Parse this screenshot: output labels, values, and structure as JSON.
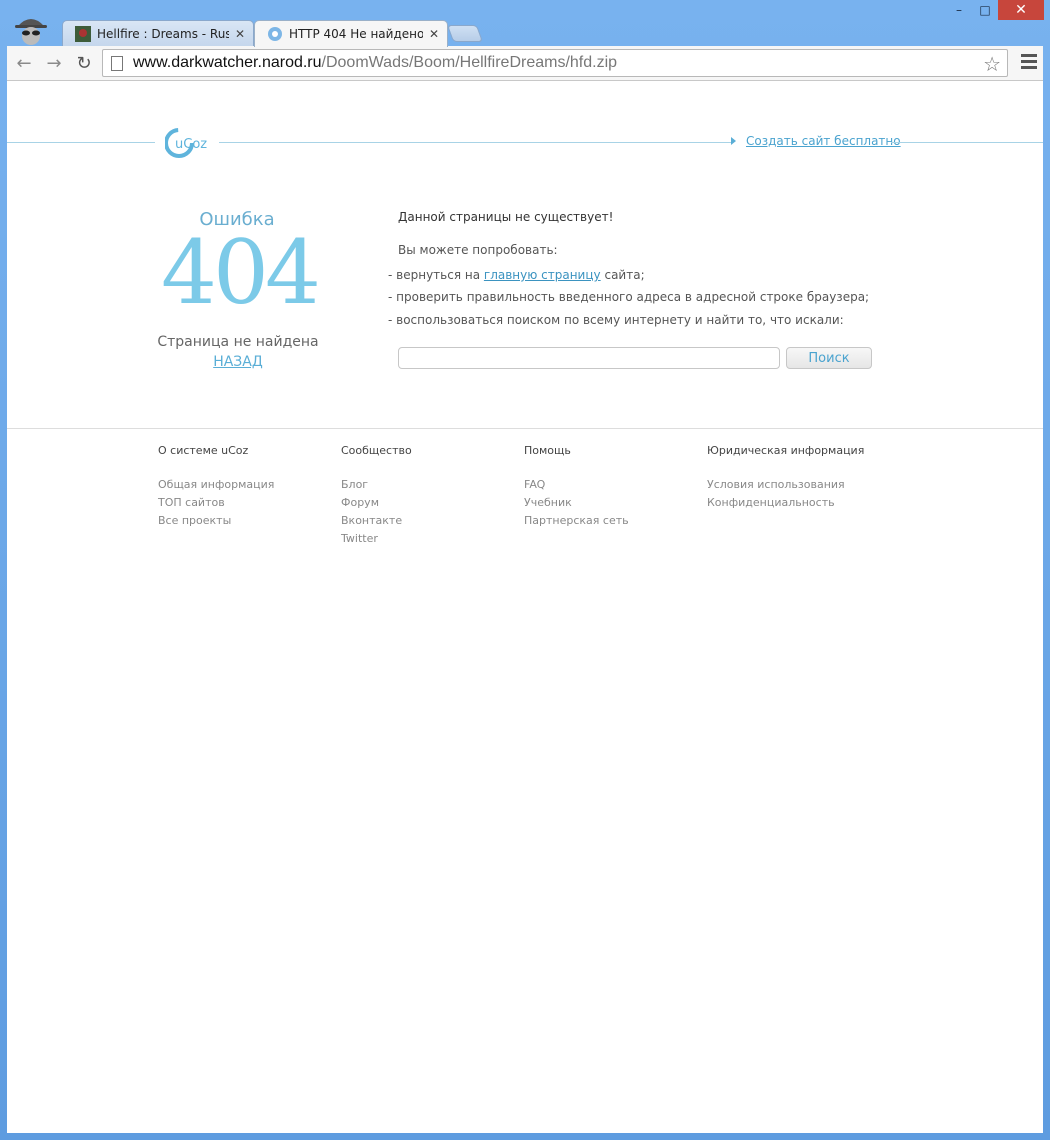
{
  "browser": {
    "tabs": [
      {
        "label": "Hellfire : Dreams - Russian",
        "active": false
      },
      {
        "label": "HTTP 404 Не найдено",
        "active": true
      }
    ],
    "url_host": "www.darkwatcher.narod.ru",
    "url_path": "/DoomWads/Boom/HellfireDreams/hfd.zip"
  },
  "header": {
    "logo_text": "uCoz",
    "create_link": "Создать сайт бесплатно"
  },
  "error": {
    "word": "Ошибка",
    "code": "404",
    "not_found": "Страница не найдена",
    "back": "НАЗАД"
  },
  "message": {
    "line1": "Данной страницы не существует!",
    "line2": "Вы можете попробовать:",
    "item1_prefix": "- вернуться на",
    "item1_link": "главную страницу",
    "item1_suffix": "сайта;",
    "item2": "- проверить правильность введенного адреса в адресной строке браузера;",
    "item3": "- воспользоваться поиском по всему интернету и найти то, что искали:"
  },
  "search": {
    "button": "Поиск"
  },
  "footer": {
    "columns": [
      {
        "heading": "О системе uCoz",
        "items": [
          "Общая информация",
          "ТОП сайтов",
          "Все проекты"
        ]
      },
      {
        "heading": "Сообщество",
        "items": [
          "Блог",
          "Форум",
          "Вконтакте",
          "Twitter"
        ]
      },
      {
        "heading": "Помощь",
        "items": [
          "FAQ",
          "Учебник",
          "Партнерская сеть"
        ]
      },
      {
        "heading": "Юридическая информация",
        "items": [
          "Условия использования",
          "Конфиденциальность"
        ]
      }
    ]
  },
  "colors": {
    "accent": "#4aa3cf",
    "code": "#7ccae8"
  }
}
